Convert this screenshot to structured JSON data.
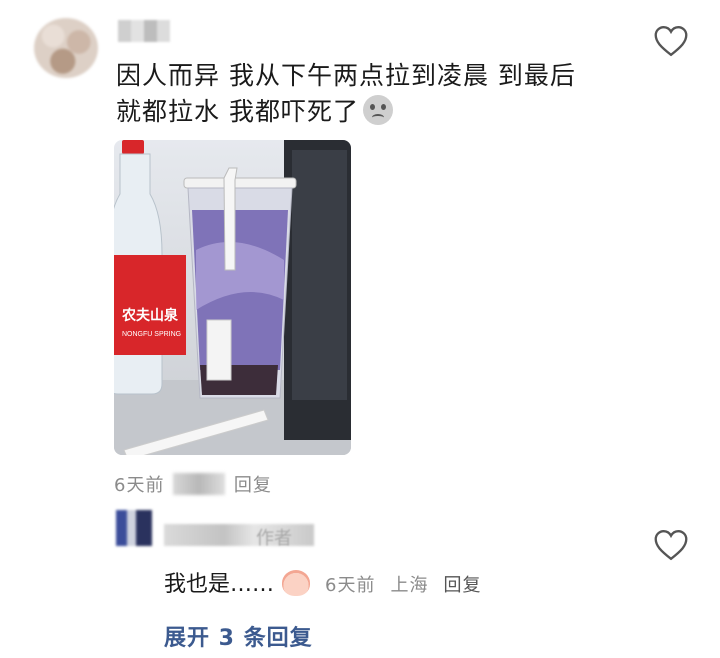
{
  "comment": {
    "text_line1": "因人而异 我从下午两点拉到凌晨 到最后",
    "text_line2": "就都拉水 我都吓死了",
    "emoji": "sweat-face-icon",
    "meta_time": "6天前",
    "meta_location_partial": "北京",
    "meta_reply": "回复"
  },
  "photo": {
    "bottle_label": "农夫山泉",
    "bottle_label_sub": "NONGFU SPRING",
    "description_colors": {
      "bottle_cap": "#d8262a",
      "bottle_label": "#d8262a",
      "drink": "#7f73b8",
      "monitor": "#2a2d33"
    }
  },
  "reply": {
    "author_suffix": "作者",
    "text": "我也是……",
    "emoji": "peach-face-icon",
    "time": "6天前",
    "location": "上海",
    "reply_label": "回复"
  },
  "expand": {
    "label": "展开 3 条回复"
  },
  "colors": {
    "link": "#3c5a8f",
    "meta": "#8b8b8b",
    "text": "#1a1a1a"
  }
}
